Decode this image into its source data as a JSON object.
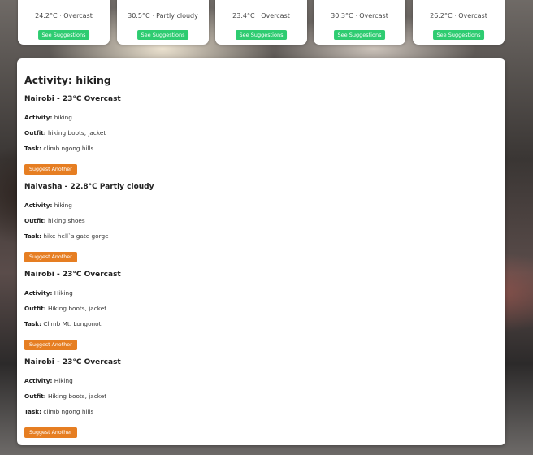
{
  "weather_cards": [
    {
      "temp": "24.2°C",
      "condition": "Overcast",
      "button": "See Suggestions"
    },
    {
      "temp": "30.5°C",
      "condition": "Partly cloudy",
      "button": "See Suggestions"
    },
    {
      "temp": "23.4°C",
      "condition": "Overcast",
      "button": "See Suggestions"
    },
    {
      "temp": "30.3°C",
      "condition": "Overcast",
      "button": "See Suggestions"
    },
    {
      "temp": "26.2°C",
      "condition": "Overcast",
      "button": "See Suggestions"
    }
  ],
  "separator": " · ",
  "panel": {
    "title": "Activity: hiking",
    "activity_label": "Activity:",
    "outfit_label": "Outfit:",
    "task_label": "Task:",
    "entries": [
      {
        "title": "Nairobi - 23°C Overcast",
        "activity": "hiking",
        "outfit": "hiking boots, jacket",
        "task": "climb ngong hills",
        "button": "Suggest Another"
      },
      {
        "title": "Naivasha - 22.8°C Partly cloudy",
        "activity": "hiking",
        "outfit": "hiking shoes",
        "task": "hike hell`s gate gorge",
        "button": "Suggest Another"
      },
      {
        "title": "Nairobi - 23°C Overcast",
        "activity": "Hiking",
        "outfit": "Hiking boots, jacket",
        "task": "Climb Mt. Longonot",
        "button": "Suggest Another"
      },
      {
        "title": "Nairobi - 23°C Overcast",
        "activity": "Hiking",
        "outfit": "Hiking boots, jacket",
        "task": "climb ngong hills",
        "button": "Suggest Another"
      }
    ]
  }
}
